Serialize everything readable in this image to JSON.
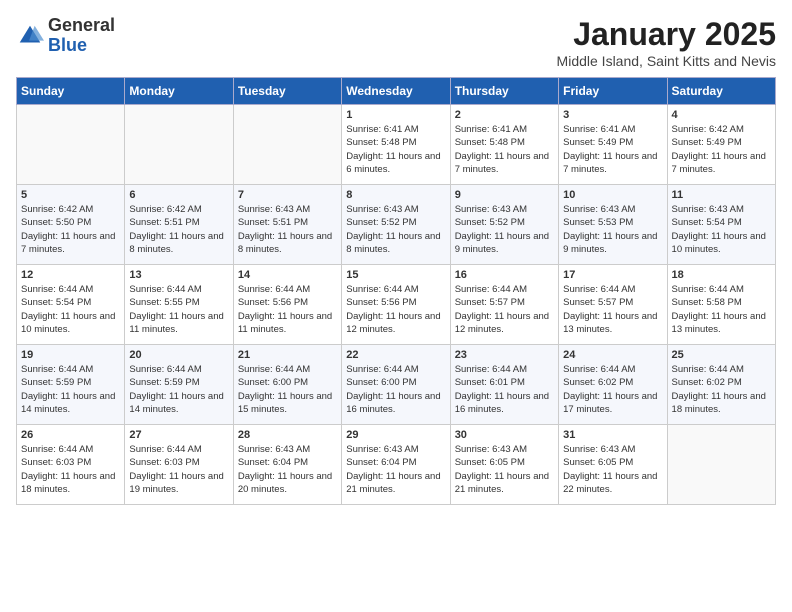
{
  "logo": {
    "general": "General",
    "blue": "Blue"
  },
  "title": "January 2025",
  "location": "Middle Island, Saint Kitts and Nevis",
  "weekdays": [
    "Sunday",
    "Monday",
    "Tuesday",
    "Wednesday",
    "Thursday",
    "Friday",
    "Saturday"
  ],
  "weeks": [
    [
      {
        "day": "",
        "sunrise": "",
        "sunset": "",
        "daylight": ""
      },
      {
        "day": "",
        "sunrise": "",
        "sunset": "",
        "daylight": ""
      },
      {
        "day": "",
        "sunrise": "",
        "sunset": "",
        "daylight": ""
      },
      {
        "day": "1",
        "sunrise": "Sunrise: 6:41 AM",
        "sunset": "Sunset: 5:48 PM",
        "daylight": "Daylight: 11 hours and 6 minutes."
      },
      {
        "day": "2",
        "sunrise": "Sunrise: 6:41 AM",
        "sunset": "Sunset: 5:48 PM",
        "daylight": "Daylight: 11 hours and 7 minutes."
      },
      {
        "day": "3",
        "sunrise": "Sunrise: 6:41 AM",
        "sunset": "Sunset: 5:49 PM",
        "daylight": "Daylight: 11 hours and 7 minutes."
      },
      {
        "day": "4",
        "sunrise": "Sunrise: 6:42 AM",
        "sunset": "Sunset: 5:49 PM",
        "daylight": "Daylight: 11 hours and 7 minutes."
      }
    ],
    [
      {
        "day": "5",
        "sunrise": "Sunrise: 6:42 AM",
        "sunset": "Sunset: 5:50 PM",
        "daylight": "Daylight: 11 hours and 7 minutes."
      },
      {
        "day": "6",
        "sunrise": "Sunrise: 6:42 AM",
        "sunset": "Sunset: 5:51 PM",
        "daylight": "Daylight: 11 hours and 8 minutes."
      },
      {
        "day": "7",
        "sunrise": "Sunrise: 6:43 AM",
        "sunset": "Sunset: 5:51 PM",
        "daylight": "Daylight: 11 hours and 8 minutes."
      },
      {
        "day": "8",
        "sunrise": "Sunrise: 6:43 AM",
        "sunset": "Sunset: 5:52 PM",
        "daylight": "Daylight: 11 hours and 8 minutes."
      },
      {
        "day": "9",
        "sunrise": "Sunrise: 6:43 AM",
        "sunset": "Sunset: 5:52 PM",
        "daylight": "Daylight: 11 hours and 9 minutes."
      },
      {
        "day": "10",
        "sunrise": "Sunrise: 6:43 AM",
        "sunset": "Sunset: 5:53 PM",
        "daylight": "Daylight: 11 hours and 9 minutes."
      },
      {
        "day": "11",
        "sunrise": "Sunrise: 6:43 AM",
        "sunset": "Sunset: 5:54 PM",
        "daylight": "Daylight: 11 hours and 10 minutes."
      }
    ],
    [
      {
        "day": "12",
        "sunrise": "Sunrise: 6:44 AM",
        "sunset": "Sunset: 5:54 PM",
        "daylight": "Daylight: 11 hours and 10 minutes."
      },
      {
        "day": "13",
        "sunrise": "Sunrise: 6:44 AM",
        "sunset": "Sunset: 5:55 PM",
        "daylight": "Daylight: 11 hours and 11 minutes."
      },
      {
        "day": "14",
        "sunrise": "Sunrise: 6:44 AM",
        "sunset": "Sunset: 5:56 PM",
        "daylight": "Daylight: 11 hours and 11 minutes."
      },
      {
        "day": "15",
        "sunrise": "Sunrise: 6:44 AM",
        "sunset": "Sunset: 5:56 PM",
        "daylight": "Daylight: 11 hours and 12 minutes."
      },
      {
        "day": "16",
        "sunrise": "Sunrise: 6:44 AM",
        "sunset": "Sunset: 5:57 PM",
        "daylight": "Daylight: 11 hours and 12 minutes."
      },
      {
        "day": "17",
        "sunrise": "Sunrise: 6:44 AM",
        "sunset": "Sunset: 5:57 PM",
        "daylight": "Daylight: 11 hours and 13 minutes."
      },
      {
        "day": "18",
        "sunrise": "Sunrise: 6:44 AM",
        "sunset": "Sunset: 5:58 PM",
        "daylight": "Daylight: 11 hours and 13 minutes."
      }
    ],
    [
      {
        "day": "19",
        "sunrise": "Sunrise: 6:44 AM",
        "sunset": "Sunset: 5:59 PM",
        "daylight": "Daylight: 11 hours and 14 minutes."
      },
      {
        "day": "20",
        "sunrise": "Sunrise: 6:44 AM",
        "sunset": "Sunset: 5:59 PM",
        "daylight": "Daylight: 11 hours and 14 minutes."
      },
      {
        "day": "21",
        "sunrise": "Sunrise: 6:44 AM",
        "sunset": "Sunset: 6:00 PM",
        "daylight": "Daylight: 11 hours and 15 minutes."
      },
      {
        "day": "22",
        "sunrise": "Sunrise: 6:44 AM",
        "sunset": "Sunset: 6:00 PM",
        "daylight": "Daylight: 11 hours and 16 minutes."
      },
      {
        "day": "23",
        "sunrise": "Sunrise: 6:44 AM",
        "sunset": "Sunset: 6:01 PM",
        "daylight": "Daylight: 11 hours and 16 minutes."
      },
      {
        "day": "24",
        "sunrise": "Sunrise: 6:44 AM",
        "sunset": "Sunset: 6:02 PM",
        "daylight": "Daylight: 11 hours and 17 minutes."
      },
      {
        "day": "25",
        "sunrise": "Sunrise: 6:44 AM",
        "sunset": "Sunset: 6:02 PM",
        "daylight": "Daylight: 11 hours and 18 minutes."
      }
    ],
    [
      {
        "day": "26",
        "sunrise": "Sunrise: 6:44 AM",
        "sunset": "Sunset: 6:03 PM",
        "daylight": "Daylight: 11 hours and 18 minutes."
      },
      {
        "day": "27",
        "sunrise": "Sunrise: 6:44 AM",
        "sunset": "Sunset: 6:03 PM",
        "daylight": "Daylight: 11 hours and 19 minutes."
      },
      {
        "day": "28",
        "sunrise": "Sunrise: 6:43 AM",
        "sunset": "Sunset: 6:04 PM",
        "daylight": "Daylight: 11 hours and 20 minutes."
      },
      {
        "day": "29",
        "sunrise": "Sunrise: 6:43 AM",
        "sunset": "Sunset: 6:04 PM",
        "daylight": "Daylight: 11 hours and 21 minutes."
      },
      {
        "day": "30",
        "sunrise": "Sunrise: 6:43 AM",
        "sunset": "Sunset: 6:05 PM",
        "daylight": "Daylight: 11 hours and 21 minutes."
      },
      {
        "day": "31",
        "sunrise": "Sunrise: 6:43 AM",
        "sunset": "Sunset: 6:05 PM",
        "daylight": "Daylight: 11 hours and 22 minutes."
      },
      {
        "day": "",
        "sunrise": "",
        "sunset": "",
        "daylight": ""
      }
    ]
  ]
}
